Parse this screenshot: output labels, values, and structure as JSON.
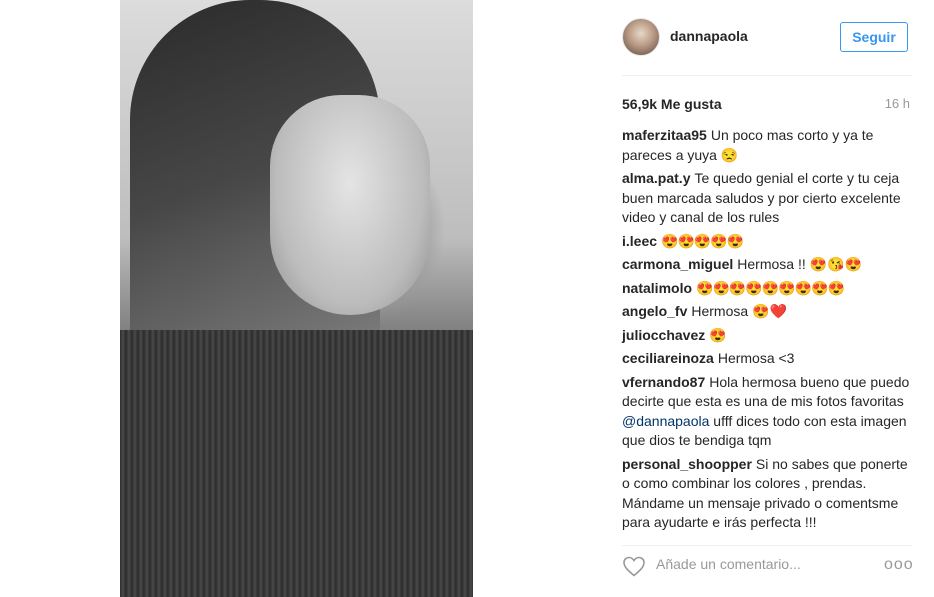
{
  "post": {
    "username": "dannapaola",
    "follow_label": "Seguir",
    "likes_label": "56,9k Me gusta",
    "time_label": "16 h",
    "add_comment_placeholder": "Añade un comentario...",
    "more_label": "ooo"
  },
  "comments": [
    {
      "user": "maferzitaa95",
      "text": "Un poco mas corto y ya te pareces a yuya 😒"
    },
    {
      "user": "alma.pat.y",
      "text": "Te quedo genial el corte y tu ceja buen marcada saludos y por cierto excelente video y canal de los rules"
    },
    {
      "user": "i.leec",
      "text": "😍😍😍😍😍"
    },
    {
      "user": "carmona_miguel",
      "text": "Hermosa !! 😍😘😍"
    },
    {
      "user": "natalimolo",
      "text": "😍😍😍😍😍😍😍😍😍"
    },
    {
      "user": "angelo_fv",
      "text": "Hermosa 😍❤️"
    },
    {
      "user": "juliocchavez",
      "text": "😍"
    },
    {
      "user": "ceciliareinoza",
      "text": "Hermosa <3"
    },
    {
      "user": "vfernando87",
      "text_before": "Hola hermosa bueno que puedo decirte que esta es una de mis fotos favoritas",
      "mention": "@dannapaola",
      "text_after": "ufff dices todo con esta imagen que dios te bendiga tqm"
    },
    {
      "user": "personal_shoopper",
      "text": "Si no sabes que ponerte o como combinar los colores , prendas. Mándame un mensaje privado o comentsme para ayudarte e irás perfecta !!!"
    }
  ]
}
